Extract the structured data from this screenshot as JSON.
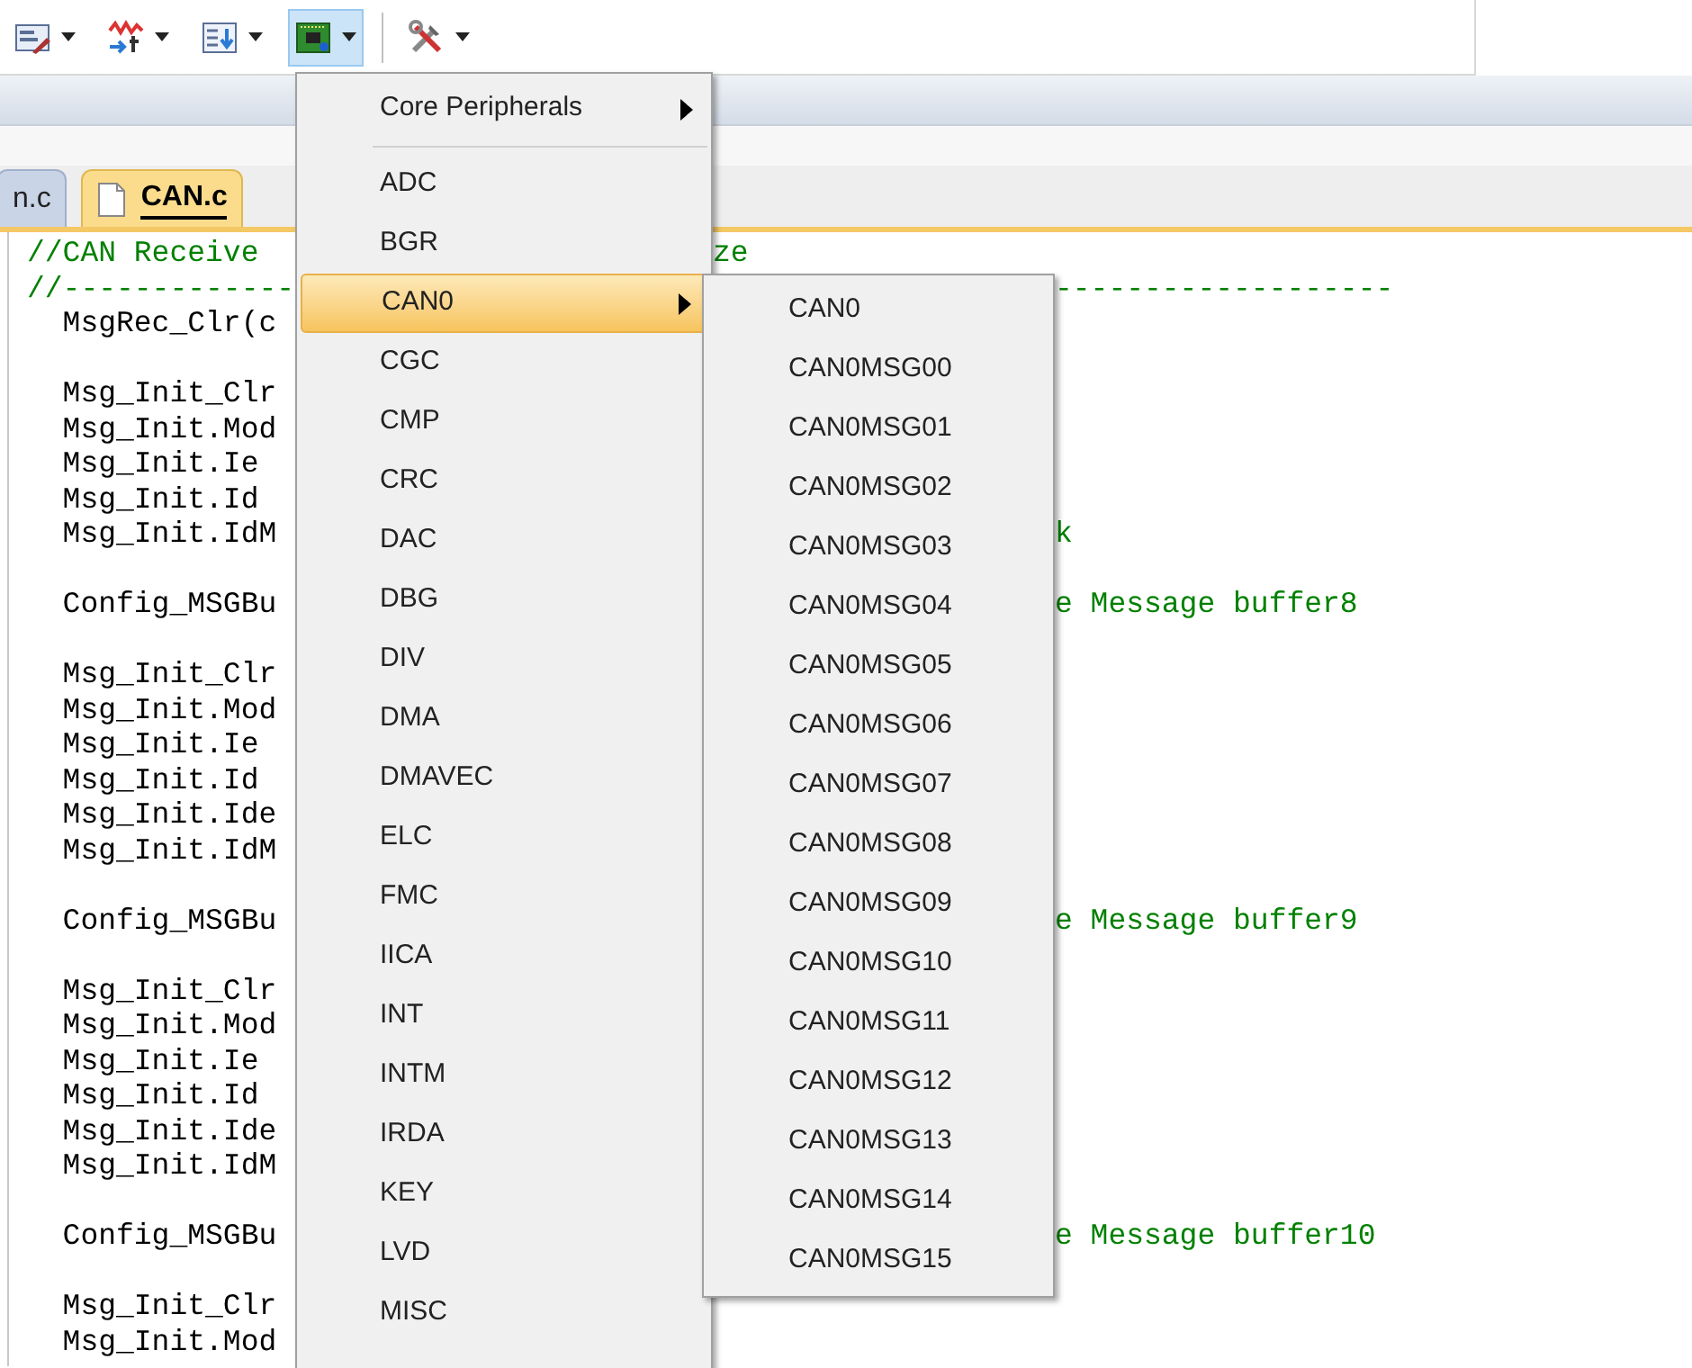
{
  "toolbar": [
    {
      "kind": "form",
      "pressed": false
    },
    {
      "kind": "trace",
      "pressed": false
    },
    {
      "kind": "list",
      "pressed": false
    },
    {
      "kind": "chip",
      "pressed": true
    },
    {
      "kind": "tools",
      "pressed": false
    }
  ],
  "tabs": [
    {
      "label": "n.c",
      "selected": false
    },
    {
      "label": "CAN.c",
      "selected": true
    }
  ],
  "code": [
    {
      "kind": "comment",
      "left": "//CAN Receive",
      "right": "ze"
    },
    {
      "kind": "comment",
      "left": "//-------------",
      "right": "-------------------"
    },
    {
      "kind": "code",
      "left": "  MsgRec_Clr(c"
    },
    {
      "kind": "blank"
    },
    {
      "kind": "code",
      "left": "  Msg_Init_Clr"
    },
    {
      "kind": "code",
      "left": "  Msg_Init.Mod"
    },
    {
      "kind": "code",
      "left": "  Msg_Init.Ie"
    },
    {
      "kind": "code",
      "left": "  Msg_Init.Id"
    },
    {
      "kind": "code",
      "left": "  Msg_Init.IdM",
      "right": "k"
    },
    {
      "kind": "blank"
    },
    {
      "kind": "code",
      "left": "  Config_MSGBu",
      "right": "e Message buffer8"
    },
    {
      "kind": "blank"
    },
    {
      "kind": "code",
      "left": "  Msg_Init_Clr"
    },
    {
      "kind": "code",
      "left": "  Msg_Init.Mod"
    },
    {
      "kind": "code",
      "left": "  Msg_Init.Ie"
    },
    {
      "kind": "code",
      "left": "  Msg_Init.Id"
    },
    {
      "kind": "code",
      "left": "  Msg_Init.Ide"
    },
    {
      "kind": "code",
      "left": "  Msg_Init.IdM"
    },
    {
      "kind": "blank"
    },
    {
      "kind": "code",
      "left": "  Config_MSGBu",
      "right": "e Message buffer9"
    },
    {
      "kind": "blank"
    },
    {
      "kind": "code",
      "left": "  Msg_Init_Clr"
    },
    {
      "kind": "code",
      "left": "  Msg_Init.Mod"
    },
    {
      "kind": "code",
      "left": "  Msg_Init.Ie"
    },
    {
      "kind": "code",
      "left": "  Msg_Init.Id"
    },
    {
      "kind": "code",
      "left": "  Msg_Init.Ide"
    },
    {
      "kind": "code",
      "left": "  Msg_Init.IdM"
    },
    {
      "kind": "blank"
    },
    {
      "kind": "code",
      "left": "  Config_MSGBu",
      "right": "e Message buffer10"
    },
    {
      "kind": "blank"
    },
    {
      "kind": "code",
      "left": "  Msg_Init_Clr"
    },
    {
      "kind": "code",
      "left": "  Msg_Init.Mod"
    }
  ],
  "menu": {
    "header": {
      "label": "Core Peripherals",
      "submenu": true
    },
    "items": [
      {
        "label": "ADC",
        "selected": false,
        "submenu": false
      },
      {
        "label": "BGR",
        "selected": false,
        "submenu": false
      },
      {
        "label": "CAN0",
        "selected": true,
        "submenu": true
      },
      {
        "label": "CGC",
        "selected": false,
        "submenu": false
      },
      {
        "label": "CMP",
        "selected": false,
        "submenu": false
      },
      {
        "label": "CRC",
        "selected": false,
        "submenu": false
      },
      {
        "label": "DAC",
        "selected": false,
        "submenu": false
      },
      {
        "label": "DBG",
        "selected": false,
        "submenu": false
      },
      {
        "label": "DIV",
        "selected": false,
        "submenu": false
      },
      {
        "label": "DMA",
        "selected": false,
        "submenu": false
      },
      {
        "label": "DMAVEC",
        "selected": false,
        "submenu": false
      },
      {
        "label": "ELC",
        "selected": false,
        "submenu": false
      },
      {
        "label": "FMC",
        "selected": false,
        "submenu": false
      },
      {
        "label": "IICA",
        "selected": false,
        "submenu": false
      },
      {
        "label": "INT",
        "selected": false,
        "submenu": false
      },
      {
        "label": "INTM",
        "selected": false,
        "submenu": false
      },
      {
        "label": "IRDA",
        "selected": false,
        "submenu": false
      },
      {
        "label": "KEY",
        "selected": false,
        "submenu": false
      },
      {
        "label": "LVD",
        "selected": false,
        "submenu": false
      },
      {
        "label": "MISC",
        "selected": false,
        "submenu": false
      }
    ]
  },
  "submenu": {
    "items": [
      "CAN0",
      "CAN0MSG00",
      "CAN0MSG01",
      "CAN0MSG02",
      "CAN0MSG03",
      "CAN0MSG04",
      "CAN0MSG05",
      "CAN0MSG06",
      "CAN0MSG07",
      "CAN0MSG08",
      "CAN0MSG09",
      "CAN0MSG10",
      "CAN0MSG11",
      "CAN0MSG12",
      "CAN0MSG13",
      "CAN0MSG14",
      "CAN0MSG15"
    ]
  }
}
